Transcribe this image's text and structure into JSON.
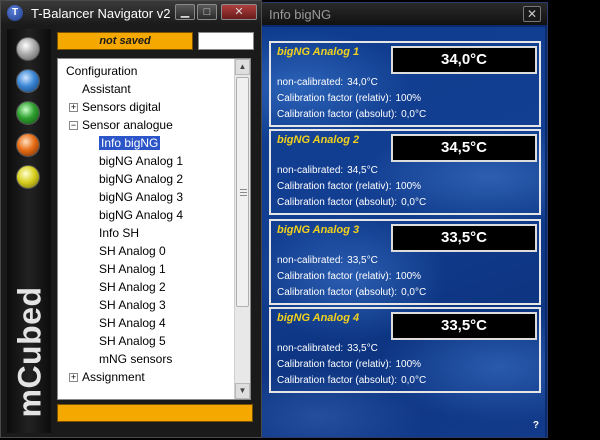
{
  "info_window": {
    "title": "Info bigNG",
    "close_label": "✕",
    "help_label": "?",
    "panels": [
      {
        "name": "bigNG Analog 1",
        "temperature": "34,0°C",
        "noncal_label": "non-calibrated:",
        "noncal_value": "34,0°C",
        "rel_label": "Calibration factor (relativ):",
        "rel_value": "100%",
        "abs_label": "Calibration factor (absolut):",
        "abs_value": "0,0°C"
      },
      {
        "name": "bigNG Analog 2",
        "temperature": "34,5°C",
        "noncal_label": "non-calibrated:",
        "noncal_value": "34,5°C",
        "rel_label": "Calibration factor (relativ):",
        "rel_value": "100%",
        "abs_label": "Calibration factor (absolut):",
        "abs_value": "0,0°C"
      },
      {
        "name": "bigNG Analog 3",
        "temperature": "33,5°C",
        "noncal_label": "non-calibrated:",
        "noncal_value": "33,5°C",
        "rel_label": "Calibration factor (relativ):",
        "rel_value": "100%",
        "abs_label": "Calibration factor (absolut):",
        "abs_value": "0,0°C"
      },
      {
        "name": "bigNG Analog 4",
        "temperature": "33,5°C",
        "noncal_label": "non-calibrated:",
        "noncal_value": "33,5°C",
        "rel_label": "Calibration factor (relativ):",
        "rel_value": "100%",
        "abs_label": "Calibration factor (absolut):",
        "abs_value": "0,0°C"
      }
    ]
  },
  "navigator": {
    "title": "T-Balancer Navigator v2",
    "app_icon_letter": "T",
    "minimize_label": "▁",
    "maximize_label": "□",
    "close_label": "✕",
    "status_text": "not saved",
    "brand_text": "mCubed",
    "leds": [
      "gray",
      "blue",
      "green",
      "orange",
      "yellow"
    ],
    "tree": [
      {
        "label": "Configuration",
        "level": 0,
        "expander": ""
      },
      {
        "label": "Assistant",
        "level": 1,
        "expander": ""
      },
      {
        "label": "Sensors digital",
        "level": 1,
        "expander": "+"
      },
      {
        "label": "Sensor analogue",
        "level": 1,
        "expander": "−"
      },
      {
        "label": "Info bigNG",
        "level": 2,
        "expander": "",
        "selected": true
      },
      {
        "label": "bigNG Analog 1",
        "level": 2,
        "expander": ""
      },
      {
        "label": "bigNG Analog 2",
        "level": 2,
        "expander": ""
      },
      {
        "label": "bigNG Analog 3",
        "level": 2,
        "expander": ""
      },
      {
        "label": "bigNG Analog 4",
        "level": 2,
        "expander": ""
      },
      {
        "label": "Info SH",
        "level": 2,
        "expander": ""
      },
      {
        "label": "SH Analog 0",
        "level": 2,
        "expander": ""
      },
      {
        "label": "SH Analog 1",
        "level": 2,
        "expander": ""
      },
      {
        "label": "SH Analog 2",
        "level": 2,
        "expander": ""
      },
      {
        "label": "SH Analog 3",
        "level": 2,
        "expander": ""
      },
      {
        "label": "SH Analog 4",
        "level": 2,
        "expander": ""
      },
      {
        "label": "SH Analog 5",
        "level": 2,
        "expander": ""
      },
      {
        "label": "mNG sensors",
        "level": 2,
        "expander": ""
      },
      {
        "label": "Assignment",
        "level": 1,
        "expander": "+"
      }
    ],
    "scroll_up": "▲",
    "scroll_down": "▼"
  }
}
